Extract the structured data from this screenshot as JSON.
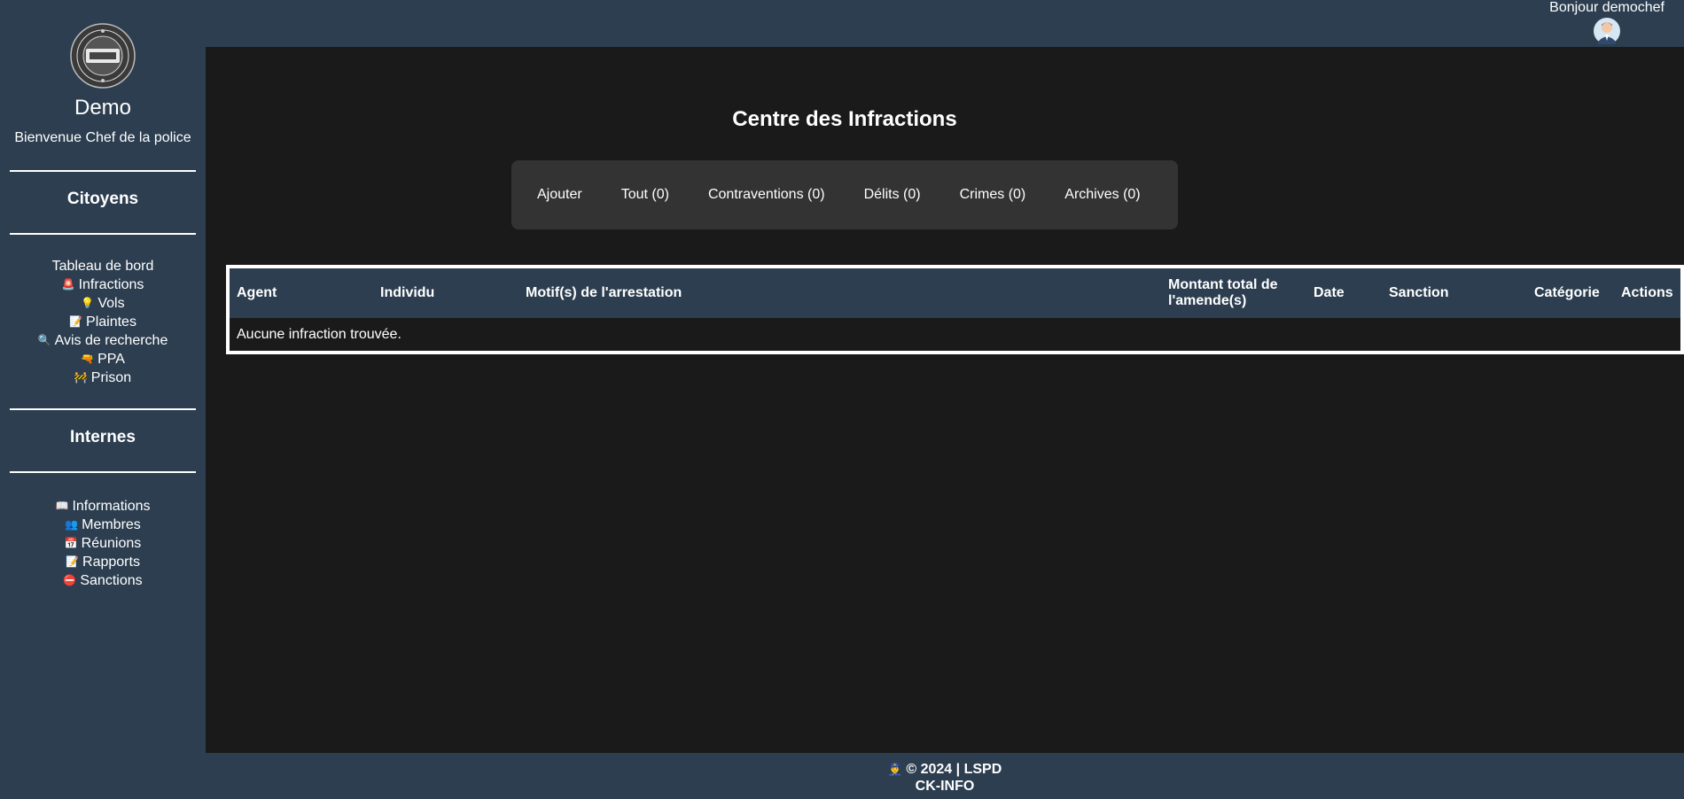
{
  "sidebar": {
    "name": "Demo",
    "welcome": "Bienvenue Chef de la police",
    "section_citoyens": "Citoyens",
    "citoyens_items": [
      {
        "icon": "",
        "label": "Tableau de bord"
      },
      {
        "icon": "🚨",
        "label": "Infractions"
      },
      {
        "icon": "💡",
        "label": "Vols"
      },
      {
        "icon": "📝",
        "label": "Plaintes"
      },
      {
        "icon": "🔍",
        "label": "Avis de recherche"
      },
      {
        "icon": "🔫",
        "label": "PPA"
      },
      {
        "icon": "🚧",
        "label": "Prison"
      }
    ],
    "section_internes": "Internes",
    "internes_items": [
      {
        "icon": "📖",
        "label": "Informations"
      },
      {
        "icon": "👥",
        "label": "Membres"
      },
      {
        "icon": "📅",
        "label": "Réunions"
      },
      {
        "icon": "📝",
        "label": "Rapports"
      },
      {
        "icon": "⛔",
        "label": "Sanctions"
      }
    ]
  },
  "header": {
    "greeting": "Bonjour demochef"
  },
  "main": {
    "title": "Centre des Infractions",
    "filters": [
      "Ajouter",
      "Tout (0)",
      "Contraventions (0)",
      "Délits (0)",
      "Crimes (0)",
      "Archives (0)"
    ],
    "table": {
      "columns": [
        "Agent",
        "Individu",
        "Motif(s) de l'arrestation",
        "Montant total de l'amende(s)",
        "Date",
        "Sanction",
        "Catégorie",
        "Actions"
      ],
      "empty_message": "Aucune infraction trouvée."
    }
  },
  "footer": {
    "line1_icon": "👮",
    "line1": "© 2024 | LSPD",
    "line2": "CK-INFO"
  },
  "colors": {
    "sidebar_bg": "#2c3e50",
    "main_bg": "#1a1a1a",
    "filter_bg": "#333333",
    "header_row_bg": "#2c3e50"
  }
}
